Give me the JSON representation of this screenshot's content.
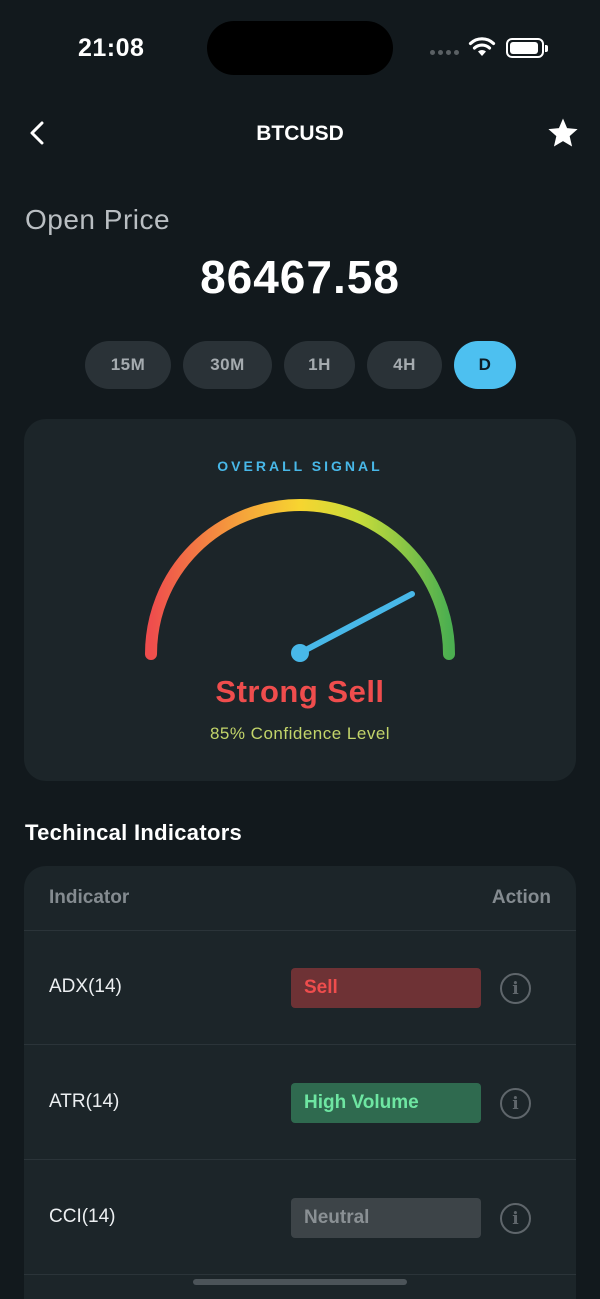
{
  "status_bar": {
    "time": "21:08"
  },
  "nav": {
    "title": "BTCUSD",
    "back_icon": "chevron-left-icon",
    "favorite_icon": "star-icon"
  },
  "price": {
    "label": "Open Price",
    "value": "86467.58"
  },
  "timeframes": [
    {
      "label": "15M",
      "active": false
    },
    {
      "label": "30M",
      "active": false
    },
    {
      "label": "1H",
      "active": false
    },
    {
      "label": "4H",
      "active": false
    },
    {
      "label": "D",
      "active": true
    }
  ],
  "signal": {
    "title": "OVERALL SIGNAL",
    "verdict": "Strong Sell",
    "confidence": "85% Confidence Level",
    "gauge_colors": [
      "#ef4d4d",
      "#f5a23b",
      "#f7d530",
      "#c7dc3a",
      "#4caf50"
    ],
    "needle_color": "#48b8e8"
  },
  "indicators": {
    "title": "Techincal Indicators",
    "columns": {
      "indicator": "Indicator",
      "action": "Action"
    },
    "rows": [
      {
        "name": "ADX(14)",
        "action": "Sell"
      },
      {
        "name": "ATR(14)",
        "action": "High Volume"
      },
      {
        "name": "CCI(14)",
        "action": "Neutral"
      }
    ]
  },
  "colors": {
    "accent": "#4dc0f0",
    "sell": "#ef4d4d",
    "sell_bg": "#6e3235",
    "high_volume": "#6ee6a2",
    "high_volume_bg": "#2f6a4f",
    "neutral": "#8a9094",
    "neutral_bg": "#3d4448"
  }
}
